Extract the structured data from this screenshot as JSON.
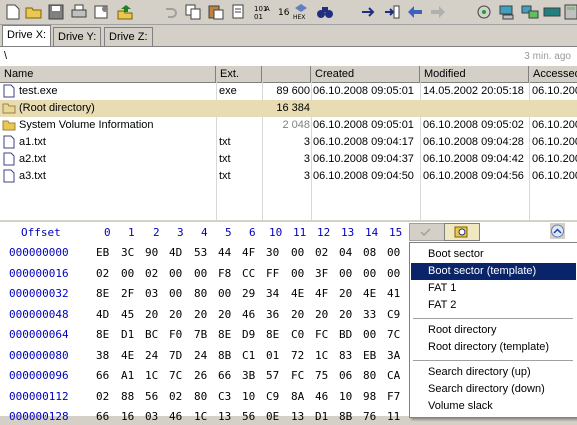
{
  "tabs": [
    {
      "label": "Drive X:"
    },
    {
      "label": "Drive Y:"
    },
    {
      "label": "Drive Z:"
    }
  ],
  "path": {
    "text": "\\",
    "time": "3 min. ago"
  },
  "columns": {
    "name": "Name",
    "ext": "Ext.",
    "size": "",
    "created": "Created",
    "modified": "Modified",
    "accessed": "Accessed"
  },
  "files": [
    {
      "name": "test.exe",
      "ext": "exe",
      "size": "89 600",
      "created": "06.10.2008  09:05:01",
      "modified": "14.05.2002  20:05:18",
      "accessed": "06.10.200"
    },
    {
      "name": "(Root directory)",
      "ext": "",
      "size": "16 384",
      "created": "",
      "modified": "",
      "accessed": ""
    },
    {
      "name": "System Volume Information",
      "ext": "",
      "size": "2 048",
      "created": "06.10.2008  09:05:01",
      "modified": "06.10.2008  09:05:02",
      "accessed": "06.10.200"
    },
    {
      "name": "a1.txt",
      "ext": "txt",
      "size": "3",
      "created": "06.10.2008  09:04:17",
      "modified": "06.10.2008  09:04:28",
      "accessed": "06.10.200"
    },
    {
      "name": "a2.txt",
      "ext": "txt",
      "size": "3",
      "created": "06.10.2008  09:04:37",
      "modified": "06.10.2008  09:04:42",
      "accessed": "06.10.200"
    },
    {
      "name": "a3.txt",
      "ext": "txt",
      "size": "3",
      "created": "06.10.2008  09:04:50",
      "modified": "06.10.2008  09:04:56",
      "accessed": "06.10.200"
    }
  ],
  "hex": {
    "offset_label": "Offset",
    "cols": [
      "0",
      "1",
      "2",
      "3",
      "4",
      "5",
      "6",
      "10",
      "11",
      "12",
      "13",
      "14",
      "15"
    ],
    "rows": [
      {
        "off": "000000000",
        "bytes": [
          "EB",
          "3C",
          "90",
          "4D",
          "53",
          "44",
          "4F",
          "30",
          "00",
          "02",
          "04",
          "08",
          "00"
        ]
      },
      {
        "off": "000000016",
        "bytes": [
          "02",
          "00",
          "02",
          "00",
          "00",
          "F8",
          "CC",
          "FF",
          "00",
          "3F",
          "00",
          "00",
          "00"
        ]
      },
      {
        "off": "000000032",
        "bytes": [
          "8E",
          "2F",
          "03",
          "00",
          "80",
          "00",
          "29",
          "34",
          "4E",
          "4F",
          "20",
          "4E",
          "41"
        ]
      },
      {
        "off": "000000048",
        "bytes": [
          "4D",
          "45",
          "20",
          "20",
          "20",
          "20",
          "46",
          "36",
          "20",
          "20",
          "20",
          "33",
          "C9"
        ]
      },
      {
        "off": "000000064",
        "bytes": [
          "8E",
          "D1",
          "BC",
          "F0",
          "7B",
          "8E",
          "D9",
          "8E",
          "C0",
          "FC",
          "BD",
          "00",
          "7C"
        ]
      },
      {
        "off": "000000080",
        "bytes": [
          "38",
          "4E",
          "24",
          "7D",
          "24",
          "8B",
          "C1",
          "01",
          "72",
          "1C",
          "83",
          "EB",
          "3A"
        ]
      },
      {
        "off": "000000096",
        "bytes": [
          "66",
          "A1",
          "1C",
          "7C",
          "26",
          "66",
          "3B",
          "57",
          "FC",
          "75",
          "06",
          "80",
          "CA"
        ]
      },
      {
        "off": "000000112",
        "bytes": [
          "02",
          "88",
          "56",
          "02",
          "80",
          "C3",
          "10",
          "C9",
          "8A",
          "46",
          "10",
          "98",
          "F7"
        ]
      },
      {
        "off": "000000128",
        "bytes": [
          "66",
          "16",
          "03",
          "46",
          "1C",
          "13",
          "56",
          "0E",
          "13",
          "D1",
          "8B",
          "76",
          "11"
        ]
      }
    ]
  },
  "template_menu": {
    "items": [
      {
        "label": "Boot sector"
      },
      {
        "label": "Boot sector (template)"
      },
      {
        "label": "FAT 1"
      },
      {
        "label": "FAT 2"
      },
      {
        "label": "Root directory"
      },
      {
        "label": "Root directory (template)"
      },
      {
        "label": "Search directory (up)"
      },
      {
        "label": "Search directory (down)"
      },
      {
        "label": "Volume slack"
      }
    ],
    "highlighted": "Boot sector (template)"
  },
  "colors": {
    "offset_blue": "#0000c0",
    "highlight": "#0a246a",
    "selected_row": "#e8dcb4"
  },
  "icons": [
    "open-folder-icon",
    "save-icon",
    "print-icon",
    "properties-icon",
    "export-icon",
    "undo-icon",
    "copy-icon",
    "paste-icon",
    "convert-icon",
    "hex-convert-icon",
    "hex-icon",
    "find-icon",
    "goto-icon",
    "jump-icon",
    "back-icon",
    "forward-icon",
    "drive-icon",
    "disk-icon",
    "network-icon",
    "ram-icon",
    "calculator-icon"
  ]
}
